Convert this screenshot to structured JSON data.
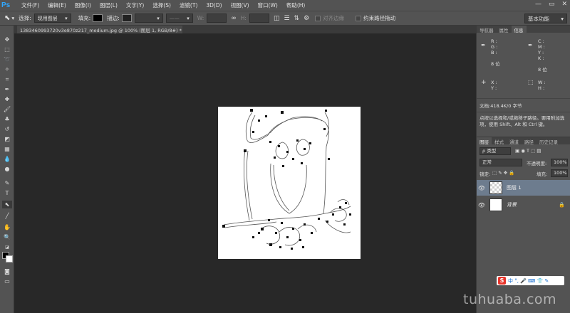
{
  "app": {
    "logo": "Ps"
  },
  "menu": [
    "文件(F)",
    "编辑(E)",
    "图像(I)",
    "图层(L)",
    "文字(Y)",
    "选择(S)",
    "滤镜(T)",
    "3D(D)",
    "视图(V)",
    "窗口(W)",
    "帮助(H)"
  ],
  "window_controls": {
    "minimize": "—",
    "maximize": "▭",
    "close": "✕"
  },
  "options": {
    "select_label": "选择:",
    "select_value": "现用图层",
    "fill_label": "填充:",
    "stroke_label": "描边:",
    "w_label": "W:",
    "h_label": "H:",
    "align_edges": "对齐边缘",
    "constrain_path": "约束路径拖动",
    "workspace": "基本功能"
  },
  "document": {
    "tab_title": "1383460993720v3e870z217_medium.jpg @ 100% (图层 1, RGB/8#) *"
  },
  "panels": {
    "top_tabs": [
      "导航器",
      "属性",
      "信息"
    ],
    "info": {
      "rgb": "R :\nG :\nB :",
      "cmyk": "C :\nM :\nY :\nK :",
      "bit_left": "8 位",
      "bit_right": "8 位",
      "xy": "X :\nY :",
      "wh": "W :\nH :"
    },
    "doc_info": "文档:418.4K/0 字节",
    "hint": "点按以选择和/或拖移子路径。要用附加选项，使用 Shift、Alt 和 Ctrl 键。",
    "layer_tabs": [
      "图层",
      "样式",
      "通道",
      "路径",
      "历史记录"
    ],
    "filter_type": "ρ 类型",
    "blend_mode": "正常",
    "opacity_label": "不透明度:",
    "opacity_value": "100%",
    "lock_label": "锁定:",
    "fill_label": "填充:",
    "fill_value": "100%",
    "layers": [
      {
        "name": "图层 1",
        "selected": true
      },
      {
        "name": "背景",
        "selected": false
      }
    ]
  },
  "ime": {
    "logo": "S",
    "text": "中 °, 🎤 ⌨ 👕 ✎"
  },
  "watermark": "tuhuaba.com"
}
